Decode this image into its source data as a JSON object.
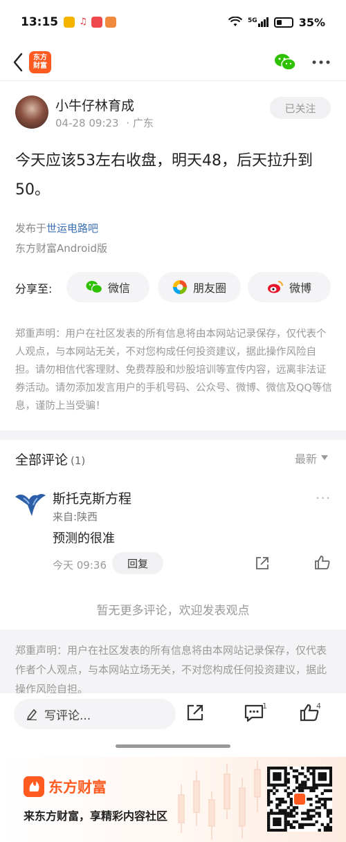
{
  "status_bar": {
    "time": "13:15",
    "network": "5G",
    "battery": "35%",
    "battery_level": 0.35
  },
  "nav": {
    "brand_logo_text": "东方财富",
    "brand_logo_line1": "东方",
    "brand_logo_line2": "财富"
  },
  "post": {
    "author": "小牛仔林育成",
    "date": "04-28 09:23",
    "location": "· 广东",
    "follow_label": "已关注",
    "content": "今天应该53左右收盘，明天48，后天拉升到50。",
    "published_in_prefix": "发布于",
    "published_in_link": "世运电路吧",
    "client": "东方财富Android版"
  },
  "share": {
    "label": "分享至:",
    "wechat": "微信",
    "moments": "朋友圈",
    "weibo": "微博"
  },
  "disclaimer": "郑重声明：用户在社区发表的所有信息将由本网站记录保存，仅代表个人观点，与本网站无关，不对您构成任何投资建议，据此操作风险自担。请勿相信代客理财、免费荐股和炒股培训等宣传内容，远离非法证券活动。请勿添加发言用户的手机号码、公众号、微博、微信及QQ等信息，谨防上当受骗！",
  "comments": {
    "title": "全部评论",
    "count": "(1)",
    "sort_label": "最新",
    "items": [
      {
        "name": "斯托克斯方程",
        "origin": "来自:陕西",
        "text": "预测的很准",
        "time": "今天 09:36",
        "reply_label": "回复"
      }
    ],
    "no_more": "暂无更多评论，欢迎发表观点"
  },
  "disclaimer2": "郑重声明：用户在社区发表的所有信息将由本网站记录保存，仅代表作者个人观点，与本网站立场无关，不对您构成任何投资建议，据此操作风险自担。",
  "action_bar": {
    "comment_placeholder": "写评论...",
    "comment_badge": "1",
    "like_badge": "4"
  },
  "footer": {
    "brand": "东方财富",
    "slogan": "来东方财富，享精彩内容社区"
  },
  "colors": {
    "brand": "#ff5a1f",
    "link": "#3a6fb5",
    "wechat": "#2dc100",
    "weibo": "#e6162d"
  }
}
